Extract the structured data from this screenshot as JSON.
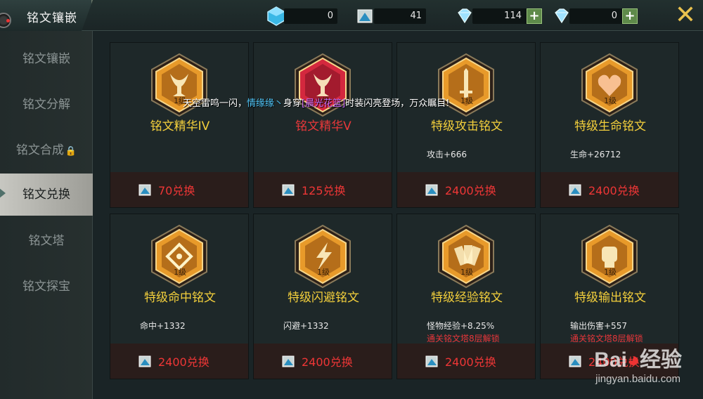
{
  "header": {
    "title": "铭文镶嵌",
    "resources": [
      {
        "name": "ice-crystal",
        "value": "0",
        "has_plus": false,
        "color": "#3ab8e6"
      },
      {
        "name": "rune-shard",
        "value": "41",
        "has_plus": false,
        "color": "#3aa0c8"
      },
      {
        "name": "diamond",
        "value": "114",
        "has_plus": true,
        "color": "#8fd8ff"
      },
      {
        "name": "bound-diamond",
        "value": "0",
        "has_plus": true,
        "color": "#8fd8ff"
      }
    ],
    "close_icon": "close-icon"
  },
  "sidebar": {
    "items": [
      {
        "label": "铭文镶嵌",
        "active": false,
        "locked": false
      },
      {
        "label": "铭文分解",
        "active": false,
        "locked": false
      },
      {
        "label": "铭文合成",
        "active": false,
        "locked": true
      },
      {
        "label": "铭文兑换",
        "active": true,
        "locked": false
      },
      {
        "label": "铭文塔",
        "active": false,
        "locked": false
      },
      {
        "label": "铭文探宝",
        "active": false,
        "locked": false
      }
    ]
  },
  "marquee": {
    "part1": "天空雷鸣一闪，",
    "player": "情缘缘丶",
    "part2": "身穿",
    "item": "[晨光花篮]",
    "part3": "时装闪亮登场，万众瞩目!"
  },
  "cards": [
    {
      "level": "1级",
      "name": "铭文精华IV",
      "name_red": false,
      "stat": "",
      "note": "",
      "price": "70兑换",
      "emblem_color": "#e89a2a",
      "glyph": "chalice"
    },
    {
      "level": "1级",
      "name": "铭文精华V",
      "name_red": true,
      "stat": "",
      "note": "",
      "price": "125兑换",
      "emblem_color": "#d4283e",
      "glyph": "chalice"
    },
    {
      "level": "1级",
      "name": "特级攻击铭文",
      "name_red": false,
      "stat": "攻击+666",
      "note": "",
      "price": "2400兑换",
      "emblem_color": "#e89a2a",
      "glyph": "sword"
    },
    {
      "level": "1级",
      "name": "特级生命铭文",
      "name_red": false,
      "stat": "生命+26712",
      "note": "",
      "price": "2400兑换",
      "emblem_color": "#e89a2a",
      "glyph": "heart"
    },
    {
      "level": "1级",
      "name": "特级命中铭文",
      "name_red": false,
      "stat": "命中+1332",
      "note": "",
      "price": "2400兑换",
      "emblem_color": "#e89a2a",
      "glyph": "target"
    },
    {
      "level": "1级",
      "name": "特级闪避铭文",
      "name_red": false,
      "stat": "闪避+1332",
      "note": "",
      "price": "2400兑换",
      "emblem_color": "#e89a2a",
      "glyph": "bolt"
    },
    {
      "level": "1级",
      "name": "特级经验铭文",
      "name_red": false,
      "stat": "怪物经验+8.25%",
      "note": "通关铭文塔8层解锁",
      "price": "2400兑换",
      "emblem_color": "#e89a2a",
      "glyph": "cards"
    },
    {
      "level": "1级",
      "name": "特级输出铭文",
      "name_red": false,
      "stat": "输出伤害+557",
      "note": "通关铭文塔8层解锁",
      "price": "2400兑换",
      "emblem_color": "#e89a2a",
      "glyph": "fist"
    }
  ],
  "watermark": {
    "logo": "Bai经验",
    "url": "jingyan.baidu.com"
  }
}
